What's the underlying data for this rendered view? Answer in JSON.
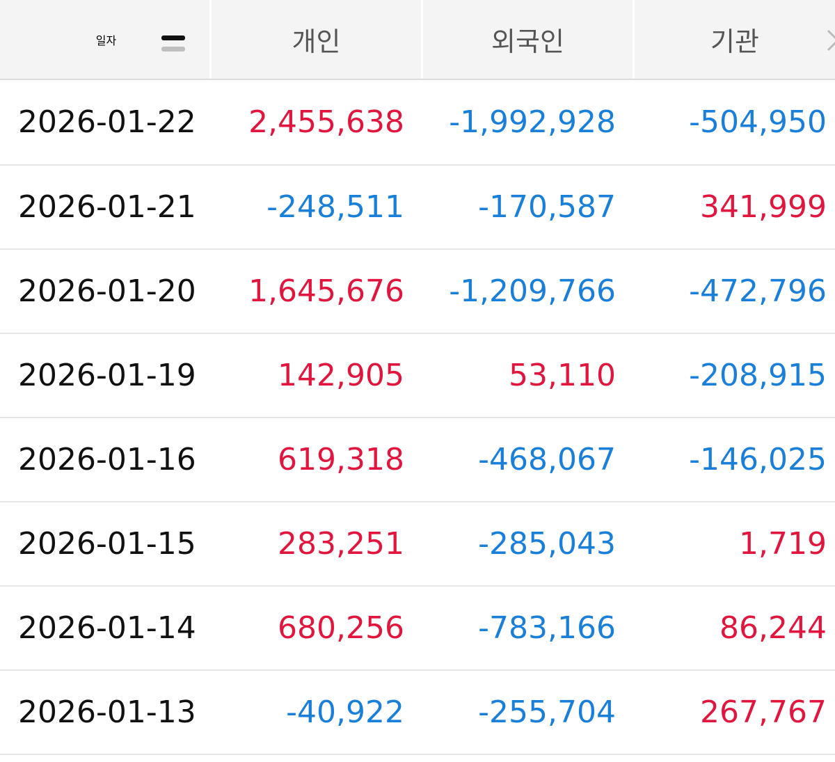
{
  "header": {
    "date_label": "일자",
    "individual_label": "개인",
    "foreign_label": "외국인",
    "institution_label": "기관"
  },
  "icons": {
    "sort": "sort-icon",
    "more": "chevron-right-icon"
  },
  "colors": {
    "positive": "#e0163e",
    "negative": "#1a7fd9",
    "header_bg": "#f4f4f4"
  },
  "rows": [
    {
      "date": "2026-01-22",
      "individual": "2,455,638",
      "foreign": "-1,992,928",
      "institution": "-504,950"
    },
    {
      "date": "2026-01-21",
      "individual": "-248,511",
      "foreign": "-170,587",
      "institution": "341,999"
    },
    {
      "date": "2026-01-20",
      "individual": "1,645,676",
      "foreign": "-1,209,766",
      "institution": "-472,796"
    },
    {
      "date": "2026-01-19",
      "individual": "142,905",
      "foreign": "53,110",
      "institution": "-208,915"
    },
    {
      "date": "2026-01-16",
      "individual": "619,318",
      "foreign": "-468,067",
      "institution": "-146,025"
    },
    {
      "date": "2026-01-15",
      "individual": "283,251",
      "foreign": "-285,043",
      "institution": "1,719"
    },
    {
      "date": "2026-01-14",
      "individual": "680,256",
      "foreign": "-783,166",
      "institution": "86,244"
    },
    {
      "date": "2026-01-13",
      "individual": "-40,922",
      "foreign": "-255,704",
      "institution": "267,767"
    }
  ]
}
